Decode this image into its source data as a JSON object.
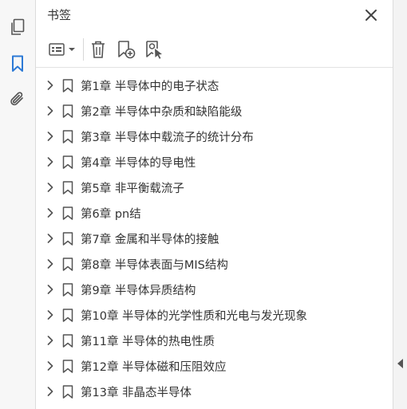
{
  "panel": {
    "title": "书签",
    "close_icon": "close-icon"
  },
  "rail": {
    "icons": [
      "pages-icon",
      "bookmark-icon",
      "attachment-icon"
    ],
    "active_color": "#2d7ad6"
  },
  "toolbar": {
    "icons": [
      "options-menu-icon",
      "delete-icon",
      "new-bookmark-icon",
      "new-bookmark-from-selection-icon"
    ]
  },
  "bookmarks": [
    {
      "label": "第1章  半导体中的电子状态"
    },
    {
      "label": "第2章  半导体中杂质和缺陷能级"
    },
    {
      "label": "第3章  半导体中载流子的统计分布"
    },
    {
      "label": "第4章  半导体的导电性"
    },
    {
      "label": "第5章  非平衡载流子"
    },
    {
      "label": "第6章  pn结"
    },
    {
      "label": "第7章  金属和半导体的接触"
    },
    {
      "label": "第8章  半导体表面与MIS结构"
    },
    {
      "label": "第9章  半导体异质结构"
    },
    {
      "label": "第10章  半导体的光学性质和光电与发光现象"
    },
    {
      "label": "第11章  半导体的热电性质"
    },
    {
      "label": "第12章  半导体磁和压阻效应"
    },
    {
      "label": "第13章  非晶态半导体"
    }
  ]
}
